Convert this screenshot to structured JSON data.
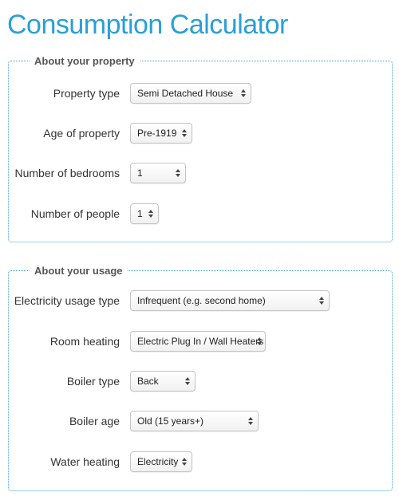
{
  "page": {
    "title": "Consumption Calculator",
    "accent_color": "#2a9fd8"
  },
  "property": {
    "legend": "About your property",
    "fields": {
      "property_type": {
        "label": "Property type",
        "value": "Semi Detached House"
      },
      "age_of_property": {
        "label": "Age of property",
        "value": "Pre-1919"
      },
      "number_of_bedrooms": {
        "label": "Number of bedrooms",
        "value": "1"
      },
      "number_of_people": {
        "label": "Number of people",
        "value": "1"
      }
    }
  },
  "usage": {
    "legend": "About your usage",
    "fields": {
      "electricity_usage_type": {
        "label": "Electricity usage type",
        "value": "Infrequent (e.g. second home)"
      },
      "room_heating": {
        "label": "Room heating",
        "value": "Electric Plug In / Wall Heaters"
      },
      "boiler_type": {
        "label": "Boiler type",
        "value": "Back"
      },
      "boiler_age": {
        "label": "Boiler age",
        "value": "Old (15 years+)"
      },
      "water_heating": {
        "label": "Water heating",
        "value": "Electricity"
      }
    }
  }
}
